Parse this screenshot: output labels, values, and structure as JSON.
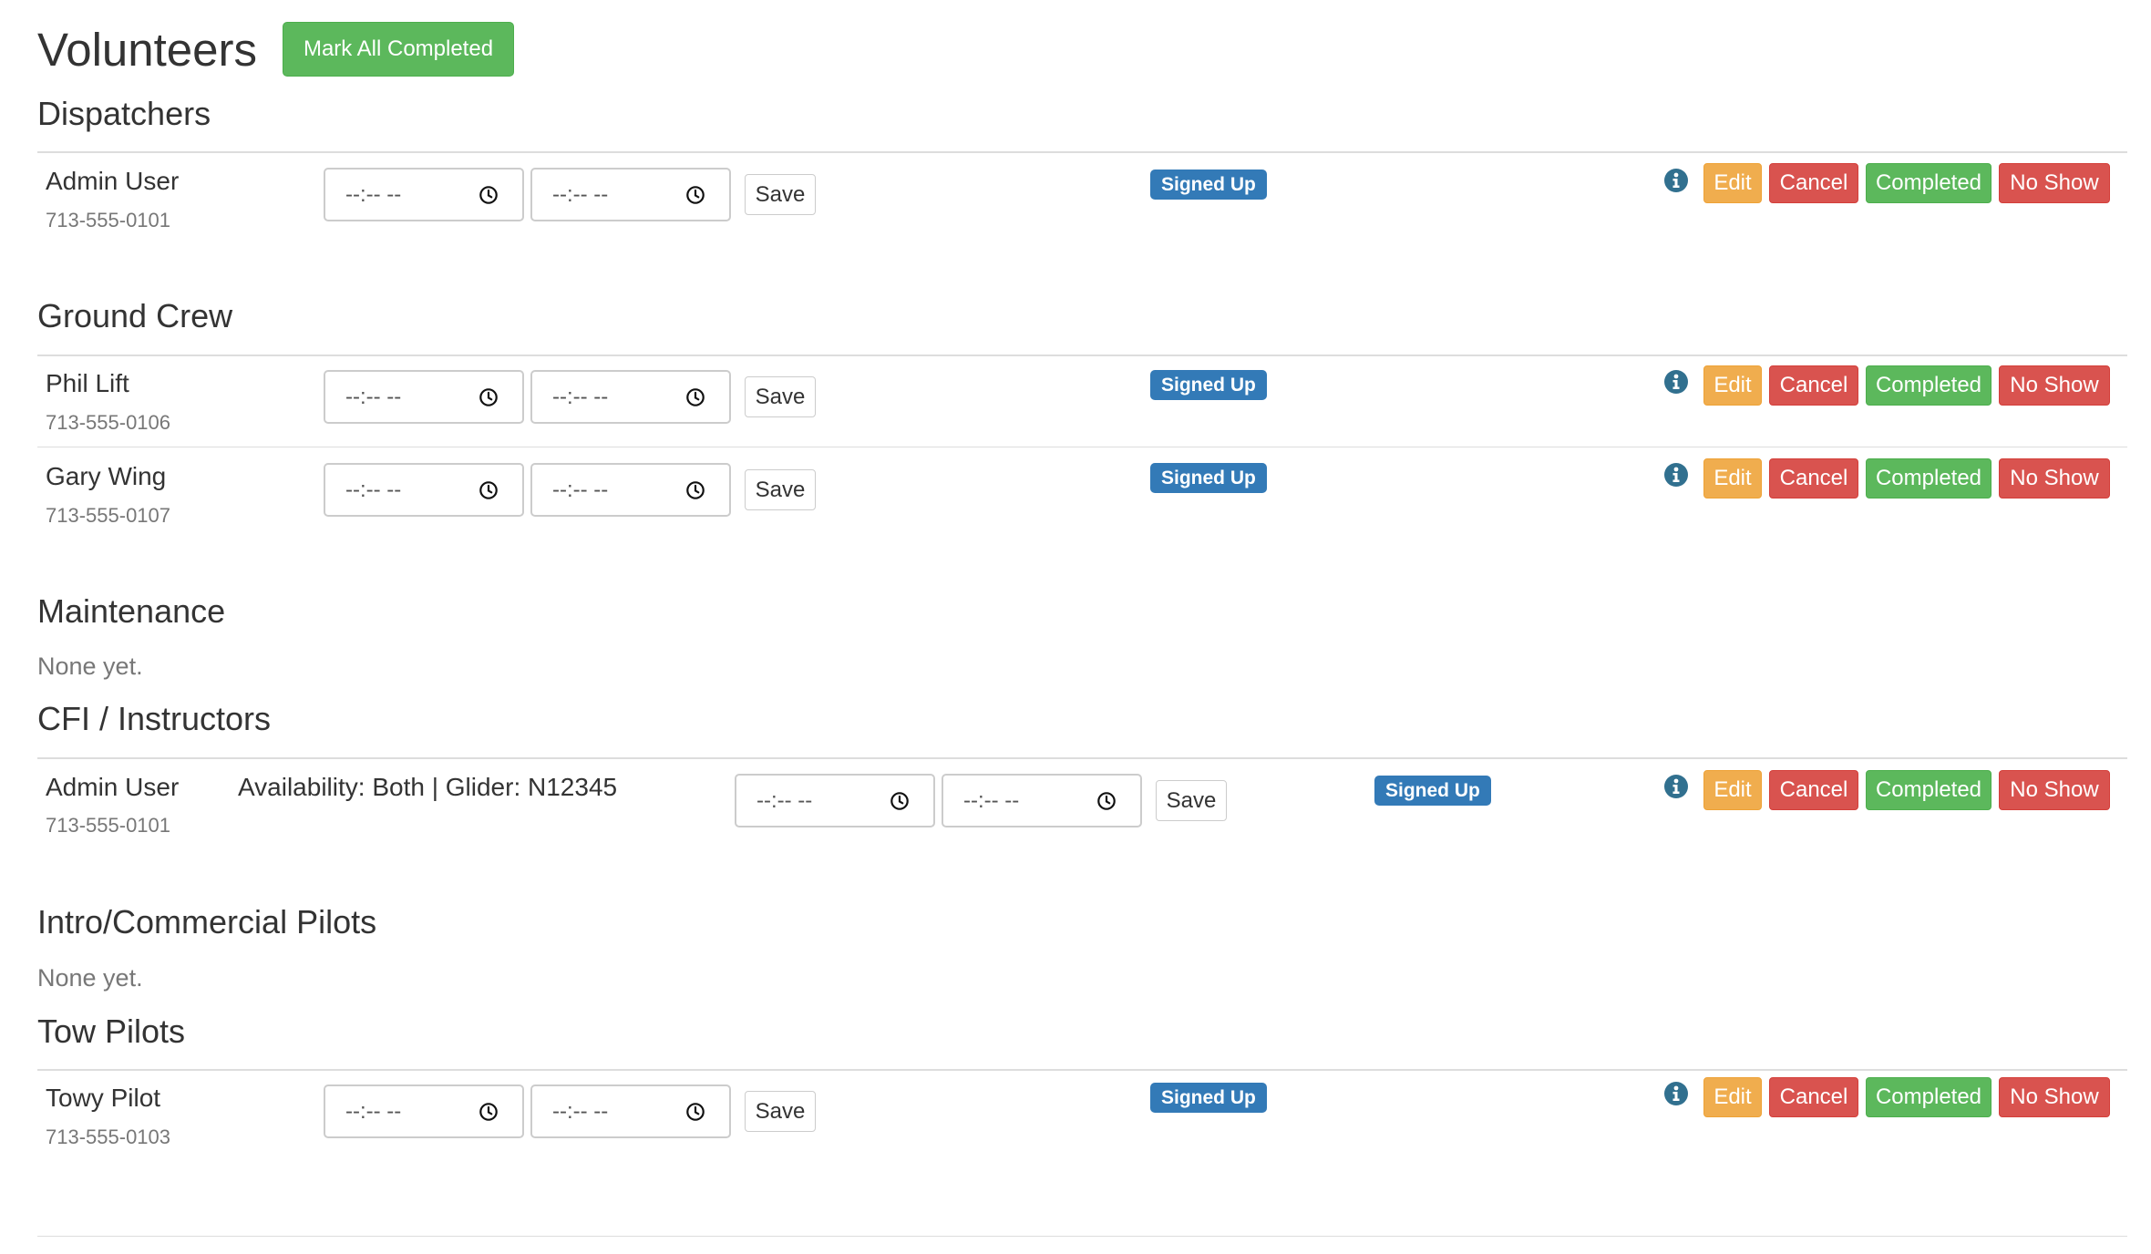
{
  "page": {
    "title": "Volunteers",
    "mark_all_label": "Mark All Completed"
  },
  "labels": {
    "save": "Save",
    "status": "Signed Up",
    "edit": "Edit",
    "cancel": "Cancel",
    "completed": "Completed",
    "no_show": "No Show",
    "time_placeholder": "--:-- --",
    "none_yet": "None yet."
  },
  "sections": {
    "dispatchers": {
      "title": "Dispatchers",
      "volunteers": [
        {
          "name": "Admin User",
          "phone": "713-555-0101"
        }
      ]
    },
    "ground_crew": {
      "title": "Ground Crew",
      "volunteers": [
        {
          "name": "Phil Lift",
          "phone": "713-555-0106"
        },
        {
          "name": "Gary Wing",
          "phone": "713-555-0107"
        }
      ]
    },
    "maintenance": {
      "title": "Maintenance"
    },
    "cfi": {
      "title": "CFI / Instructors",
      "volunteers": [
        {
          "name": "Admin User",
          "phone": "713-555-0101",
          "details": "Availability: Both | Glider: N12345"
        }
      ]
    },
    "intro": {
      "title": "Intro/Commercial Pilots"
    },
    "tow": {
      "title": "Tow Pilots",
      "volunteers": [
        {
          "name": "Towy Pilot",
          "phone": "713-555-0103"
        }
      ]
    }
  },
  "colors": {
    "primary": "#337ab7",
    "success": "#5cb85c",
    "warning": "#f0ad4e",
    "danger": "#d9534f",
    "info_icon": "#31708f"
  },
  "icons": {
    "clock": "clock-icon",
    "info": "info-icon"
  }
}
